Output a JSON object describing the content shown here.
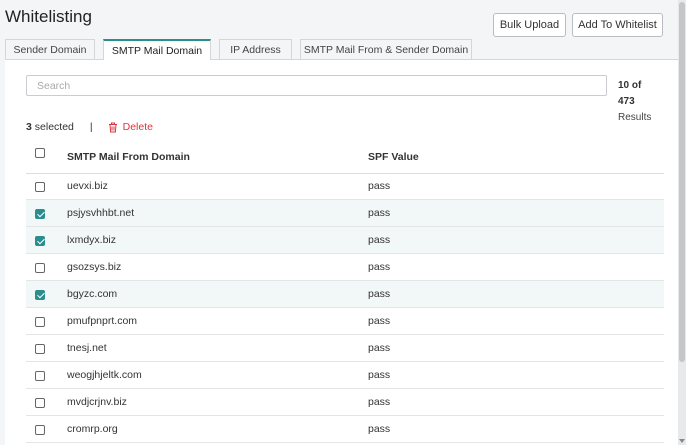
{
  "page": {
    "title": "Whitelisting"
  },
  "header": {
    "bulk_upload": "Bulk Upload",
    "add_to_whitelist": "Add To Whitelist"
  },
  "tabs": [
    {
      "label": "Sender Domain",
      "active": false
    },
    {
      "label": "SMTP Mail Domain",
      "active": true
    },
    {
      "label": "IP Address",
      "active": false
    },
    {
      "label": "SMTP Mail From & Sender Domain",
      "active": false
    }
  ],
  "search": {
    "placeholder": "Search",
    "value": ""
  },
  "results": {
    "shown": "10 of",
    "total": "473",
    "label": "Results"
  },
  "selection": {
    "count": "3",
    "label": "selected",
    "separator": "|",
    "delete_label": "Delete"
  },
  "table": {
    "columns": [
      "SMTP Mail From Domain",
      "SPF Value"
    ],
    "rows": [
      {
        "domain": "uevxi.biz",
        "spf": "pass",
        "checked": false
      },
      {
        "domain": "psjysvhhbt.net",
        "spf": "pass",
        "checked": true
      },
      {
        "domain": "lxmdyx.biz",
        "spf": "pass",
        "checked": true
      },
      {
        "domain": "gsozsys.biz",
        "spf": "pass",
        "checked": false
      },
      {
        "domain": "bgyzc.com",
        "spf": "pass",
        "checked": true
      },
      {
        "domain": "pmufpnprt.com",
        "spf": "pass",
        "checked": false
      },
      {
        "domain": "tnesj.net",
        "spf": "pass",
        "checked": false
      },
      {
        "domain": "weogjhjeltk.com",
        "spf": "pass",
        "checked": false
      },
      {
        "domain": "mvdjcrjnv.biz",
        "spf": "pass",
        "checked": false
      },
      {
        "domain": "cromrp.org",
        "spf": "pass",
        "checked": false
      }
    ]
  },
  "colors": {
    "accent": "#2a8e8e",
    "danger": "#d9363e",
    "selected_row": "#f2f7f8"
  }
}
